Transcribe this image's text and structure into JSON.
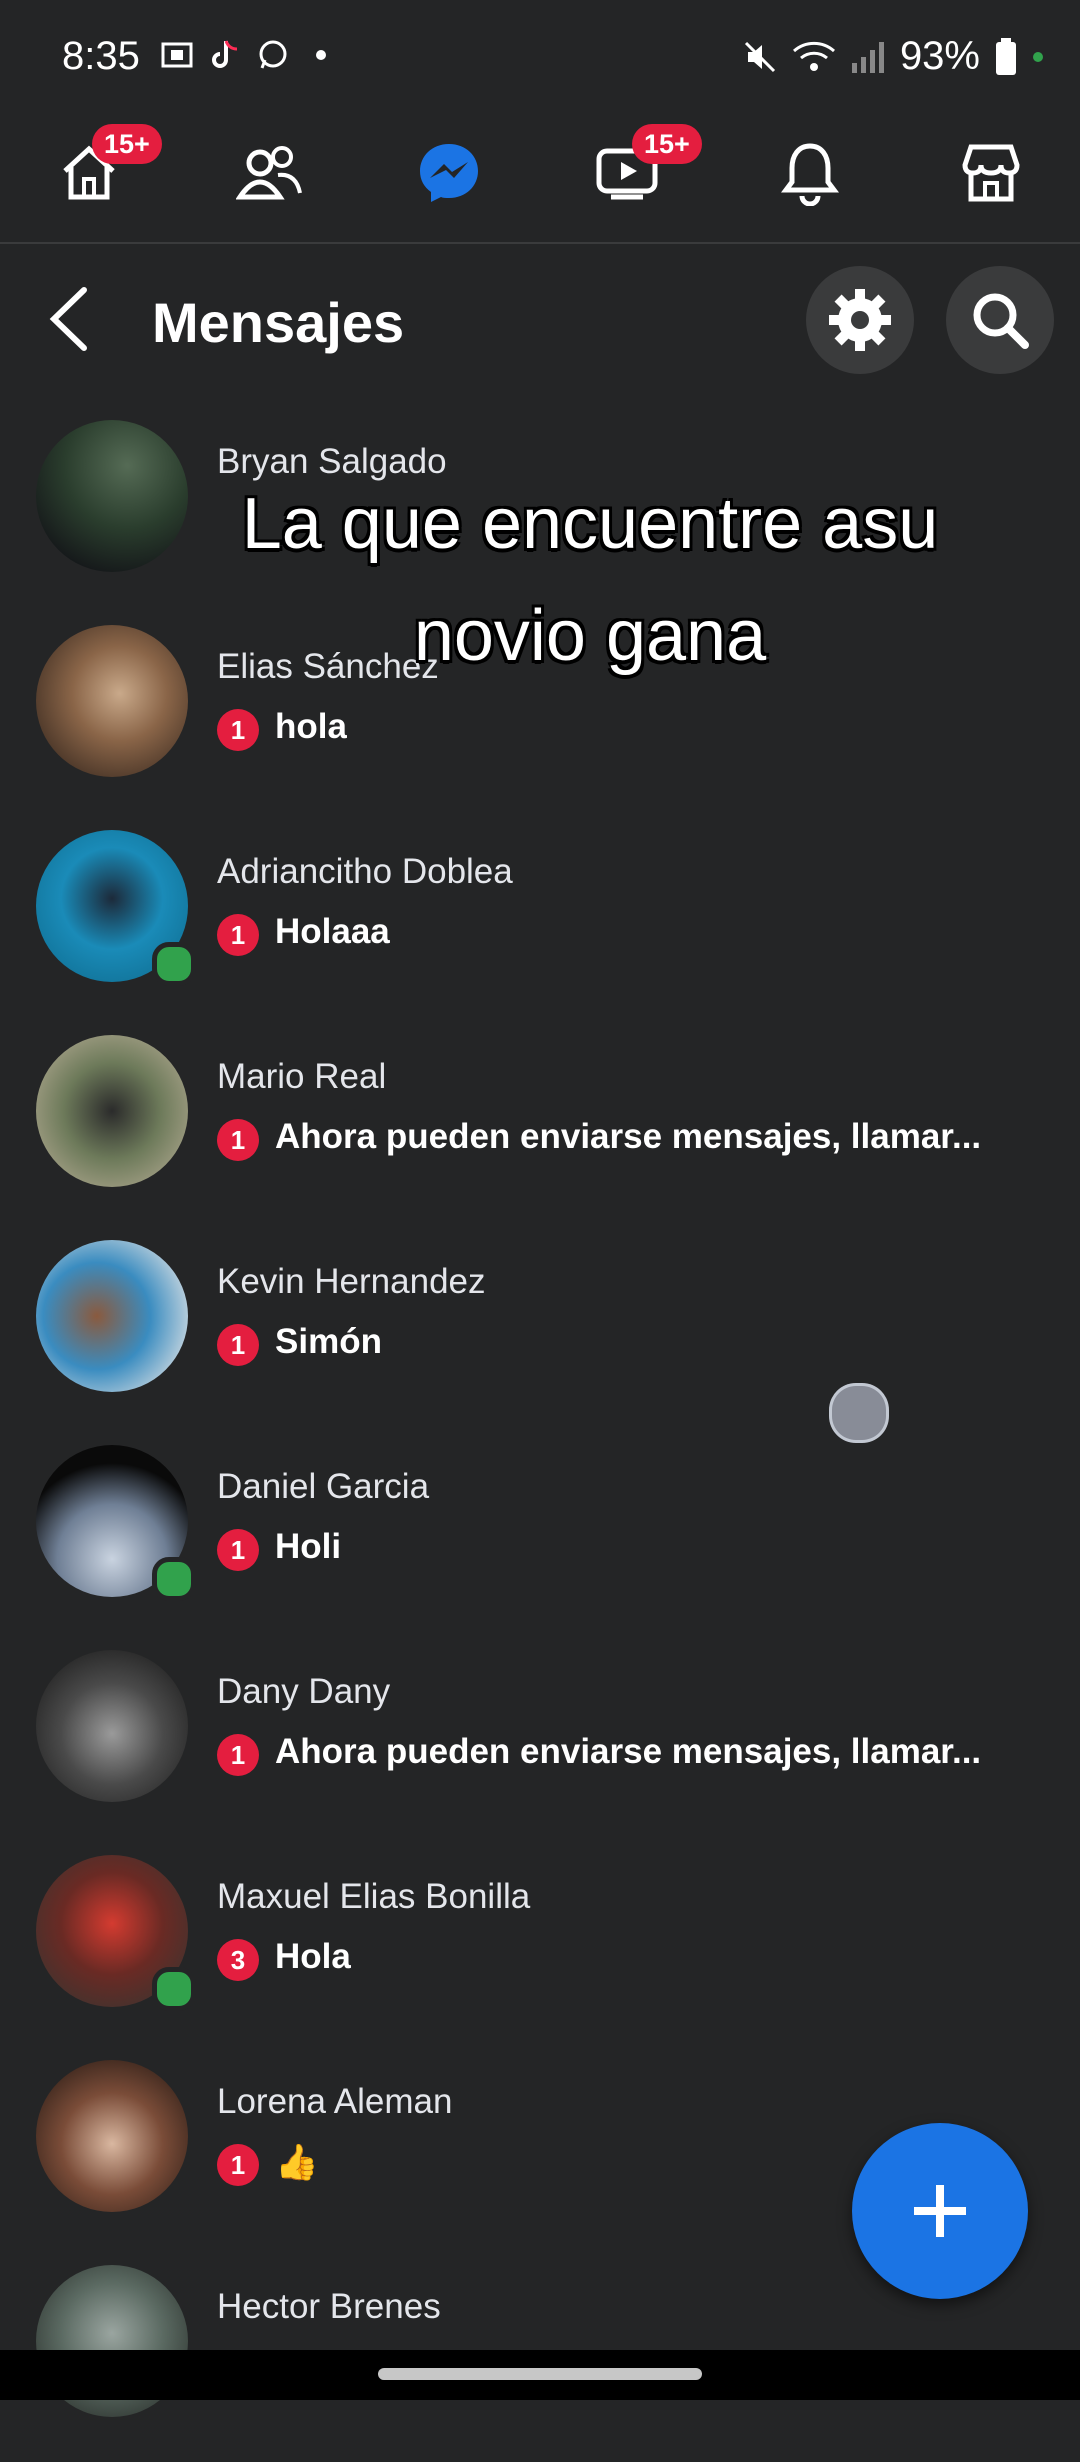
{
  "status_bar": {
    "time": "8:35",
    "battery": "93%",
    "left_icons": [
      "screenshot-icon",
      "tiktok-icon",
      "whatsapp-icon",
      "dot-icon"
    ],
    "right_icons": [
      "mute-icon",
      "wifi-icon",
      "signal-icon",
      "battery-icon"
    ]
  },
  "nav": {
    "items": [
      {
        "name": "home",
        "icon": "home-icon",
        "badge": "15+"
      },
      {
        "name": "friends",
        "icon": "friends-icon",
        "badge": ""
      },
      {
        "name": "messenger",
        "icon": "messenger-icon",
        "badge": "",
        "active": true
      },
      {
        "name": "video",
        "icon": "video-icon",
        "badge": "15+"
      },
      {
        "name": "notifications",
        "icon": "bell-icon",
        "badge": ""
      },
      {
        "name": "marketplace",
        "icon": "marketplace-icon",
        "badge": ""
      }
    ],
    "active_color": "#1b74e4"
  },
  "header": {
    "title": "Mensajes"
  },
  "overlay": {
    "line1": "La que encuentre asu",
    "line2": "novio gana"
  },
  "conversations": [
    {
      "name": "Bryan Salgado",
      "badge": "",
      "preview": "",
      "online": false
    },
    {
      "name": "Elias Sánchez",
      "badge": "1",
      "preview": "hola",
      "online": false
    },
    {
      "name": "Adriancitho Doblea",
      "badge": "1",
      "preview": "Holaaa",
      "online": true
    },
    {
      "name": "Mario Real",
      "badge": "1",
      "preview": "Ahora pueden enviarse mensajes, llamar...",
      "online": false
    },
    {
      "name": "Kevin Hernandez",
      "badge": "1",
      "preview": "Simón",
      "online": false
    },
    {
      "name": "Daniel Garcia",
      "badge": "1",
      "preview": "Holi",
      "online": true
    },
    {
      "name": "Dany Dany",
      "badge": "1",
      "preview": "Ahora pueden enviarse mensajes, llamar...",
      "online": false
    },
    {
      "name": "Maxuel Elias Bonilla",
      "badge": "3",
      "preview": "Hola",
      "online": true
    },
    {
      "name": "Lorena Aleman",
      "badge": "1",
      "preview": "👍",
      "online": false
    },
    {
      "name": "Hector Brenes",
      "badge": "",
      "preview": "",
      "online": false
    }
  ],
  "colors": {
    "background": "#242526",
    "badge": "#e41e3f",
    "accent": "#1b74e4",
    "online": "#31a24c"
  }
}
